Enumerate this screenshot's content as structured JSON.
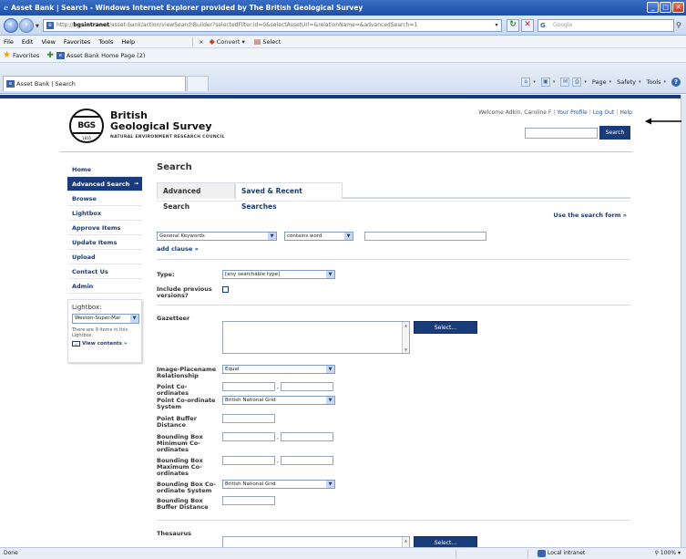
{
  "window": {
    "title": "Asset Bank | Search - Windows Internet Explorer provided by The British Geological Survey",
    "minimize_glyph": "_",
    "maximize_glyph": "□"
  },
  "address": {
    "url_prefix": "http://",
    "url_host": "bgsintranet",
    "url_path": "/asset-bank/action/viewSearchBuilder?selectedFilter.id=0&selectAssetUrl=&relationName=&advancedSearch=1",
    "search_placeholder": "Google"
  },
  "menu": {
    "items": [
      "File",
      "Edit",
      "View",
      "Favorites",
      "Tools",
      "Help"
    ],
    "convert_label": "Convert",
    "select_label": "Select"
  },
  "favorites": {
    "label": "Favorites",
    "link_label": "Asset Bank Home Page (2)"
  },
  "browser_tab": {
    "label": "Asset Bank | Search"
  },
  "commandbar": {
    "page_label": "Page",
    "safety_label": "Safety",
    "tools_label": "Tools"
  },
  "header": {
    "org_line1": "British",
    "org_line2": "Geological Survey",
    "org_line3": "NATURAL ENVIRONMENT RESEARCH COUNCIL",
    "logo_text": "BGS",
    "logo_year": "1835",
    "welcome": "Welcome Adkin, Caroline F",
    "your_profile": "Your Profile",
    "log_out": "Log Out",
    "help": "Help",
    "search_button": "Search"
  },
  "sidebar": {
    "items": [
      {
        "label": "Home"
      },
      {
        "label": "Advanced Search",
        "arrow": "→"
      },
      {
        "label": "Browse"
      },
      {
        "label": "Lightbox"
      },
      {
        "label": "Approve Items"
      },
      {
        "label": "Update Items"
      },
      {
        "label": "Upload"
      },
      {
        "label": "Contact Us"
      },
      {
        "label": "Admin"
      }
    ],
    "lightbox": {
      "title": "Lightbox:",
      "selected": "Weston-Super-Mar",
      "info": "There are 9 items in this Lightbox.",
      "view_contents": "View contents »"
    }
  },
  "main": {
    "title": "Search",
    "tabs": [
      "Advanced Search",
      "Saved & Recent Searches"
    ],
    "use_search_form": "Use the search form »",
    "clause": {
      "field": "General Keywords",
      "operator": "contains word",
      "value": ""
    },
    "add_clause": "add clause »",
    "type_label": "Type:",
    "type_value": "[any searchable type]",
    "include_previous_label": "Include previous versions?",
    "gazetteer_label": "Gazetteer",
    "select_button": "Select...",
    "relationship_label": "Image-Placename Relationship",
    "relationship_value": "Equal",
    "point_coords_label": "Point Co-ordinates",
    "point_system_label": "Point Co-ordinate System",
    "point_system_value": "British National Grid",
    "point_buffer_label": "Point Buffer Distance",
    "bbox_min_label": "Bounding Box Minimum Co-ordinates",
    "bbox_max_label": "Bounding Box Maximum Co-ordinates",
    "bbox_system_label": "Bounding Box Co-ordinate System",
    "bbox_system_value": "British National Grid",
    "bbox_buffer_label": "Bounding Box Buffer Distance",
    "thesaurus_label": "Thesaurus",
    "coord_sep": ","
  },
  "status": {
    "left": "Done",
    "zone": "Local intranet",
    "zoom": "100%"
  },
  "colors": {
    "brand_navy": "#1a3b7a",
    "link_blue": "#2a4f94"
  }
}
